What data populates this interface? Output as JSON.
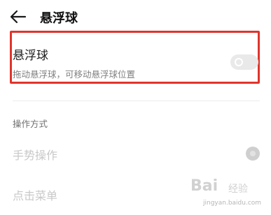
{
  "header": {
    "back_icon": "arrow-left-icon",
    "title": "悬浮球"
  },
  "floating_ball": {
    "title": "悬浮球",
    "subtitle": "拖动悬浮球，可移动悬浮球位置",
    "toggle_on": false,
    "toggle_icon": "toggle-switch-icon",
    "highlight_color": "#e0342c"
  },
  "operation": {
    "section_title": "操作方式",
    "options": [
      {
        "label": "手势操作",
        "selected": true
      },
      {
        "label": "点击菜单",
        "selected": false
      }
    ]
  },
  "watermark": {
    "brand": "Bai",
    "brand_tail": "经验",
    "url": "jingyan.baidu.com"
  }
}
